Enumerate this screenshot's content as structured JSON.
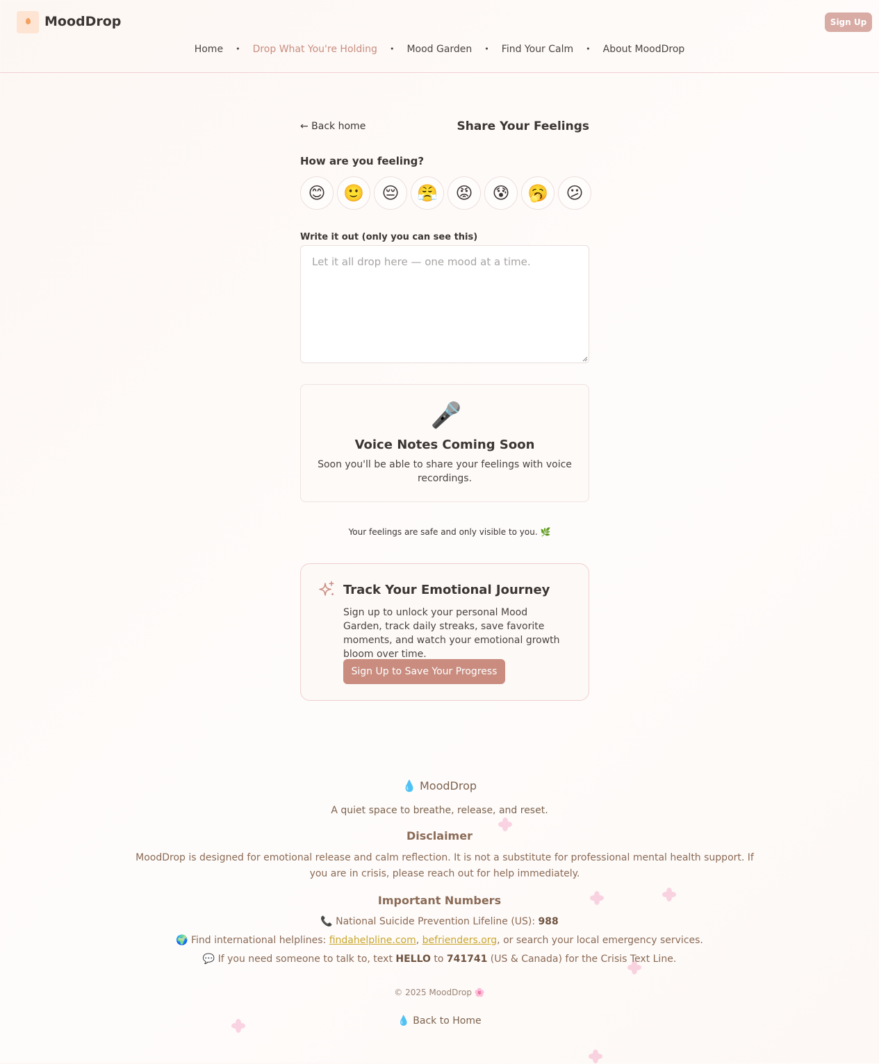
{
  "header": {
    "brand": "MoodDrop",
    "signup_label": "Sign Up",
    "nav": [
      {
        "label": "Home",
        "active": false
      },
      {
        "label": "Drop What You're Holding",
        "active": true
      },
      {
        "label": "Mood Garden",
        "active": false
      },
      {
        "label": "Find Your Calm",
        "active": false
      },
      {
        "label": "About MoodDrop",
        "active": false
      }
    ]
  },
  "main": {
    "back_label": "← Back home",
    "title": "Share Your Feelings",
    "feeling_question": "How are you feeling?",
    "moods": [
      "😊",
      "🙂",
      "😔",
      "😤",
      "😡",
      "😰",
      "🥱",
      "😕"
    ],
    "write_label": "Write it out (only you can see this)",
    "write_placeholder": "Let it all drop here — one mood at a time.",
    "write_value": "",
    "voice": {
      "icon": "🎤",
      "title": "Voice Notes Coming Soon",
      "description": "Soon you'll be able to share your feelings with voice recordings."
    },
    "safe_note": "Your feelings are safe and only visible to you. 🌿",
    "track": {
      "title": "Track Your Emotional Journey",
      "description": "Sign up to unlock your personal Mood Garden, track daily streaks, save favorite moments, and watch your emotional growth bloom over time.",
      "button_label": "Sign Up to Save Your Progress"
    }
  },
  "footer": {
    "brand": "💧 MoodDrop",
    "tagline": "A quiet space to breathe, release, and reset.",
    "disclaimer_heading": "Disclaimer",
    "disclaimer": "MoodDrop is designed for emotional release and calm reflection. It is not a substitute for professional mental health support. If you are in crisis, please reach out for help immediately.",
    "numbers_heading": "Important Numbers",
    "lifeline_prefix": "📞 National Suicide Prevention Lifeline (US): ",
    "lifeline_number": "988",
    "intl_prefix": "🌍 Find international helplines: ",
    "intl_link1": "findahelpline.com",
    "intl_sep": ", ",
    "intl_link2": "befrienders.org",
    "intl_suffix": ", or search your local emergency services.",
    "text_prefix": "💬 If you need someone to talk to, text ",
    "text_keyword": "HELLO",
    "text_mid": " to ",
    "text_number": "741741",
    "text_suffix": " (US & Canada) for the Crisis Text Line.",
    "copyright": "© 2025 MoodDrop 🌸",
    "back_home": "💧 Back to Home"
  },
  "colors": {
    "accent": "#c98c7f",
    "signup_button": "#d8aba4",
    "footer_text": "#8a6a55",
    "link": "#c9a52a",
    "header_border": "#f1cfd3"
  }
}
